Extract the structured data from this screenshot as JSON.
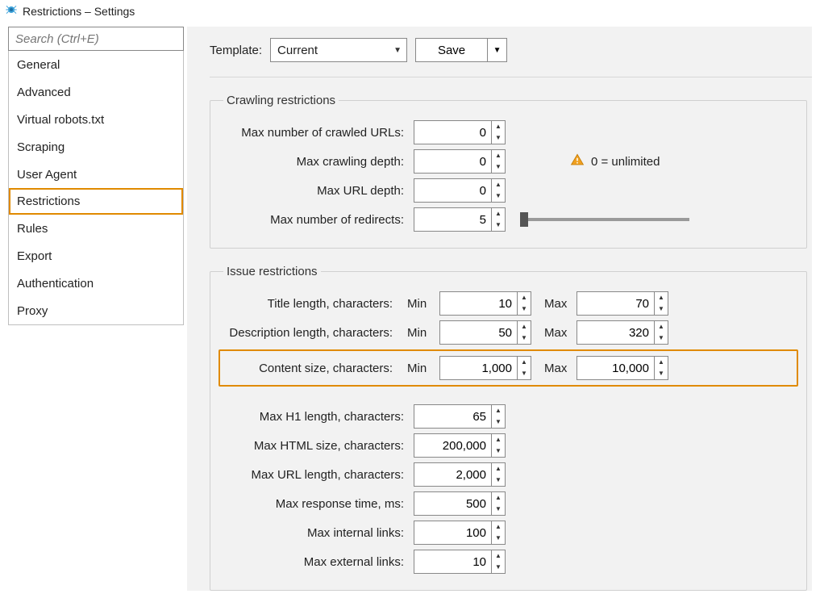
{
  "window": {
    "title": "Restrictions – Settings"
  },
  "search": {
    "placeholder": "Search (Ctrl+E)"
  },
  "sidebar": {
    "items": [
      {
        "label": "General"
      },
      {
        "label": "Advanced"
      },
      {
        "label": "Virtual robots.txt"
      },
      {
        "label": "Scraping"
      },
      {
        "label": "User Agent"
      },
      {
        "label": "Restrictions",
        "selected": true
      },
      {
        "label": "Rules"
      },
      {
        "label": "Export"
      },
      {
        "label": "Authentication"
      },
      {
        "label": "Proxy"
      }
    ]
  },
  "toolbar": {
    "template_label": "Template:",
    "template_value": "Current",
    "save_label": "Save"
  },
  "crawling": {
    "legend": "Crawling restrictions",
    "max_urls_label": "Max number of crawled URLs:",
    "max_urls_value": "0",
    "max_depth_label": "Max crawling depth:",
    "max_depth_value": "0",
    "max_url_depth_label": "Max URL depth:",
    "max_url_depth_value": "0",
    "max_redirects_label": "Max number of redirects:",
    "max_redirects_value": "5",
    "unlimited_text": "0 = unlimited"
  },
  "issue": {
    "legend": "Issue restrictions",
    "min_label": "Min",
    "max_label": "Max",
    "title_len_label": "Title length, characters:",
    "title_len_min": "10",
    "title_len_max": "70",
    "desc_len_label": "Description length, characters:",
    "desc_len_min": "50",
    "desc_len_max": "320",
    "content_size_label": "Content size, characters:",
    "content_size_min": "1,000",
    "content_size_max": "10,000",
    "h1_len_label": "Max H1 length, characters:",
    "h1_len_value": "65",
    "html_size_label": "Max HTML size, characters:",
    "html_size_value": "200,000",
    "url_len_label": "Max URL length, characters:",
    "url_len_value": "2,000",
    "resp_time_label": "Max response time, ms:",
    "resp_time_value": "500",
    "int_links_label": "Max internal links:",
    "int_links_value": "100",
    "ext_links_label": "Max external links:",
    "ext_links_value": "10"
  }
}
